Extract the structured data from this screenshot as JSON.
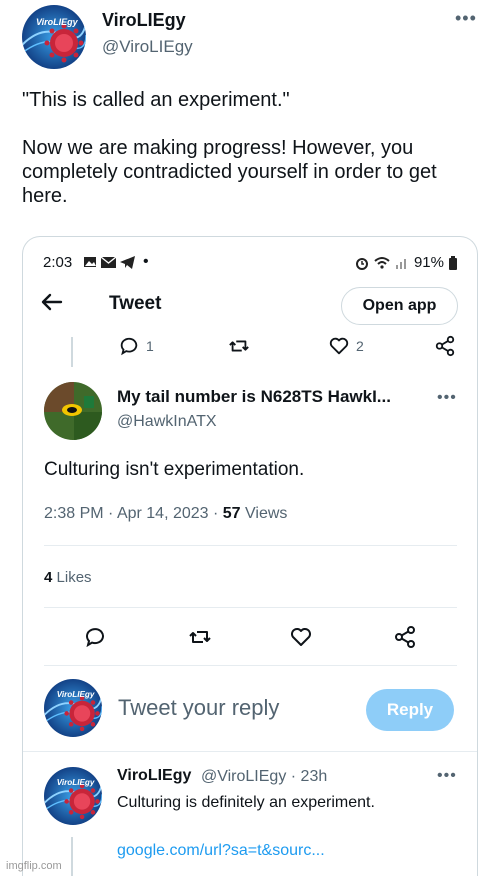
{
  "outer": {
    "display_name": "ViroLIEgy",
    "handle": "@ViroLIEgy",
    "more_icon": "more-horizontal-icon",
    "text": "\"This is called an experiment.\"\n\nNow we are making progress! However, you completely contradicted yourself in order to get here."
  },
  "phone": {
    "status": {
      "time": "2:03",
      "battery": "91%"
    },
    "header": {
      "title": "Tweet",
      "open_app_label": "Open app"
    },
    "prev_actions": {
      "reply_count": "1",
      "like_count": "2"
    },
    "main_tweet": {
      "display_name": "My tail number is N628TS HawkI...",
      "handle": "@HawkInATX",
      "text": "Culturing isn't experimentation.",
      "time": "2:38 PM",
      "date": "Apr 14, 2023",
      "views_count": "57",
      "views_label": "Views",
      "likes_count": "4",
      "likes_label": "Likes"
    },
    "reply_box": {
      "placeholder": "Tweet your reply",
      "button_label": "Reply"
    },
    "reply_tweet": {
      "display_name": "ViroLIEgy",
      "handle_time": "@ViroLIEgy · 23h",
      "text": "Culturing is definitely an experiment.",
      "link": "google.com/url?sa=t&sourc..."
    }
  },
  "watermark": "imgflip.com",
  "colors": {
    "accent": "#1d9bf0",
    "reply_button": "#8ecdf8",
    "secondary_text": "#536471"
  }
}
